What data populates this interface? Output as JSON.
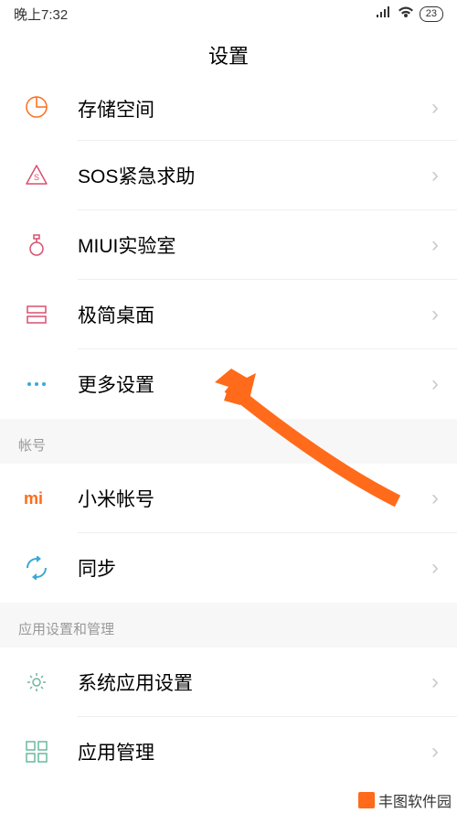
{
  "statusBar": {
    "time": "晚上7:32",
    "battery": "23"
  },
  "header": {
    "title": "设置"
  },
  "items": [
    {
      "icon": "storage",
      "label": "存储空间"
    },
    {
      "icon": "sos",
      "label": "SOS紧急求助"
    },
    {
      "icon": "lab",
      "label": "MIUI实验室"
    },
    {
      "icon": "simple",
      "label": "极简桌面"
    },
    {
      "icon": "more",
      "label": "更多设置"
    }
  ],
  "sections": {
    "account": "帐号",
    "apps": "应用设置和管理"
  },
  "accountItems": [
    {
      "icon": "mi",
      "label": "小米帐号"
    },
    {
      "icon": "sync",
      "label": "同步"
    }
  ],
  "appItems": [
    {
      "icon": "gear",
      "label": "系统应用设置"
    },
    {
      "icon": "grid",
      "label": "应用管理"
    }
  ],
  "watermark": "丰图软件园"
}
